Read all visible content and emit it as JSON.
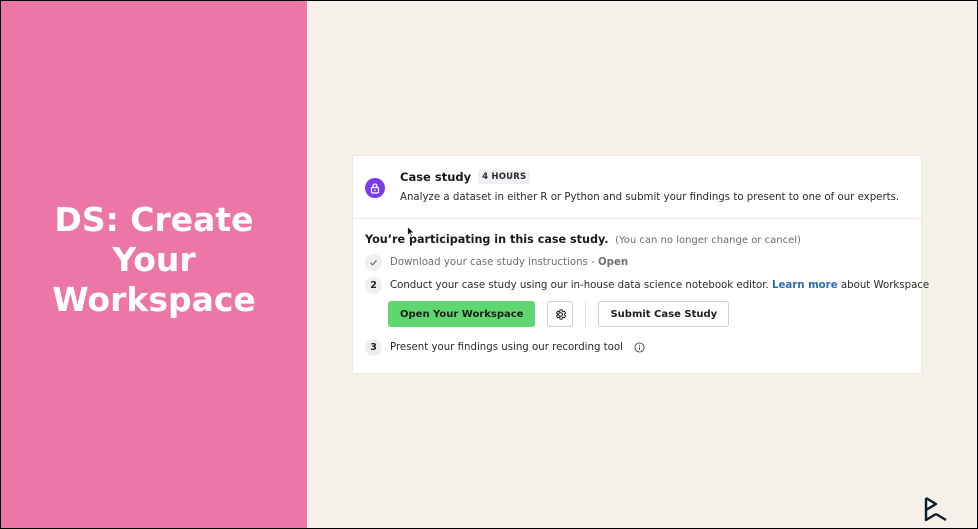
{
  "left": {
    "title": "DS: Create Your Workspace"
  },
  "card": {
    "title": "Case study",
    "duration_badge": "4 HOURS",
    "description": "Analyze a dataset in either R or Python and submit your findings to present to one of our experts.",
    "participating_label": "You’re participating in this case study.",
    "participating_note": "(You can no longer change or cancel)",
    "steps": [
      {
        "marker": "✓",
        "text": "Download your case study instructions",
        "separator": " - ",
        "status": "Open"
      },
      {
        "marker": "2",
        "text_before": "Conduct your case study using our in-house data science notebook editor.",
        "link_text": "Learn more",
        "text_after": "about Workspace"
      },
      {
        "marker": "3",
        "text": "Present your findings using our recording tool"
      }
    ],
    "buttons": {
      "open_workspace": "Open Your Workspace",
      "submit": "Submit Case Study"
    }
  },
  "icons": {
    "lock": "lock-icon",
    "check": "check-icon",
    "gear": "gear-icon",
    "info": "info-icon",
    "cursor": "cursor-icon",
    "logo": "datacamp-logo-icon"
  },
  "colors": {
    "left_bg": "#ec77a6",
    "right_bg": "#f5f1ea",
    "lock_badge": "#7c3aed",
    "primary_button": "#5fd771",
    "link": "#2d6bb5"
  }
}
